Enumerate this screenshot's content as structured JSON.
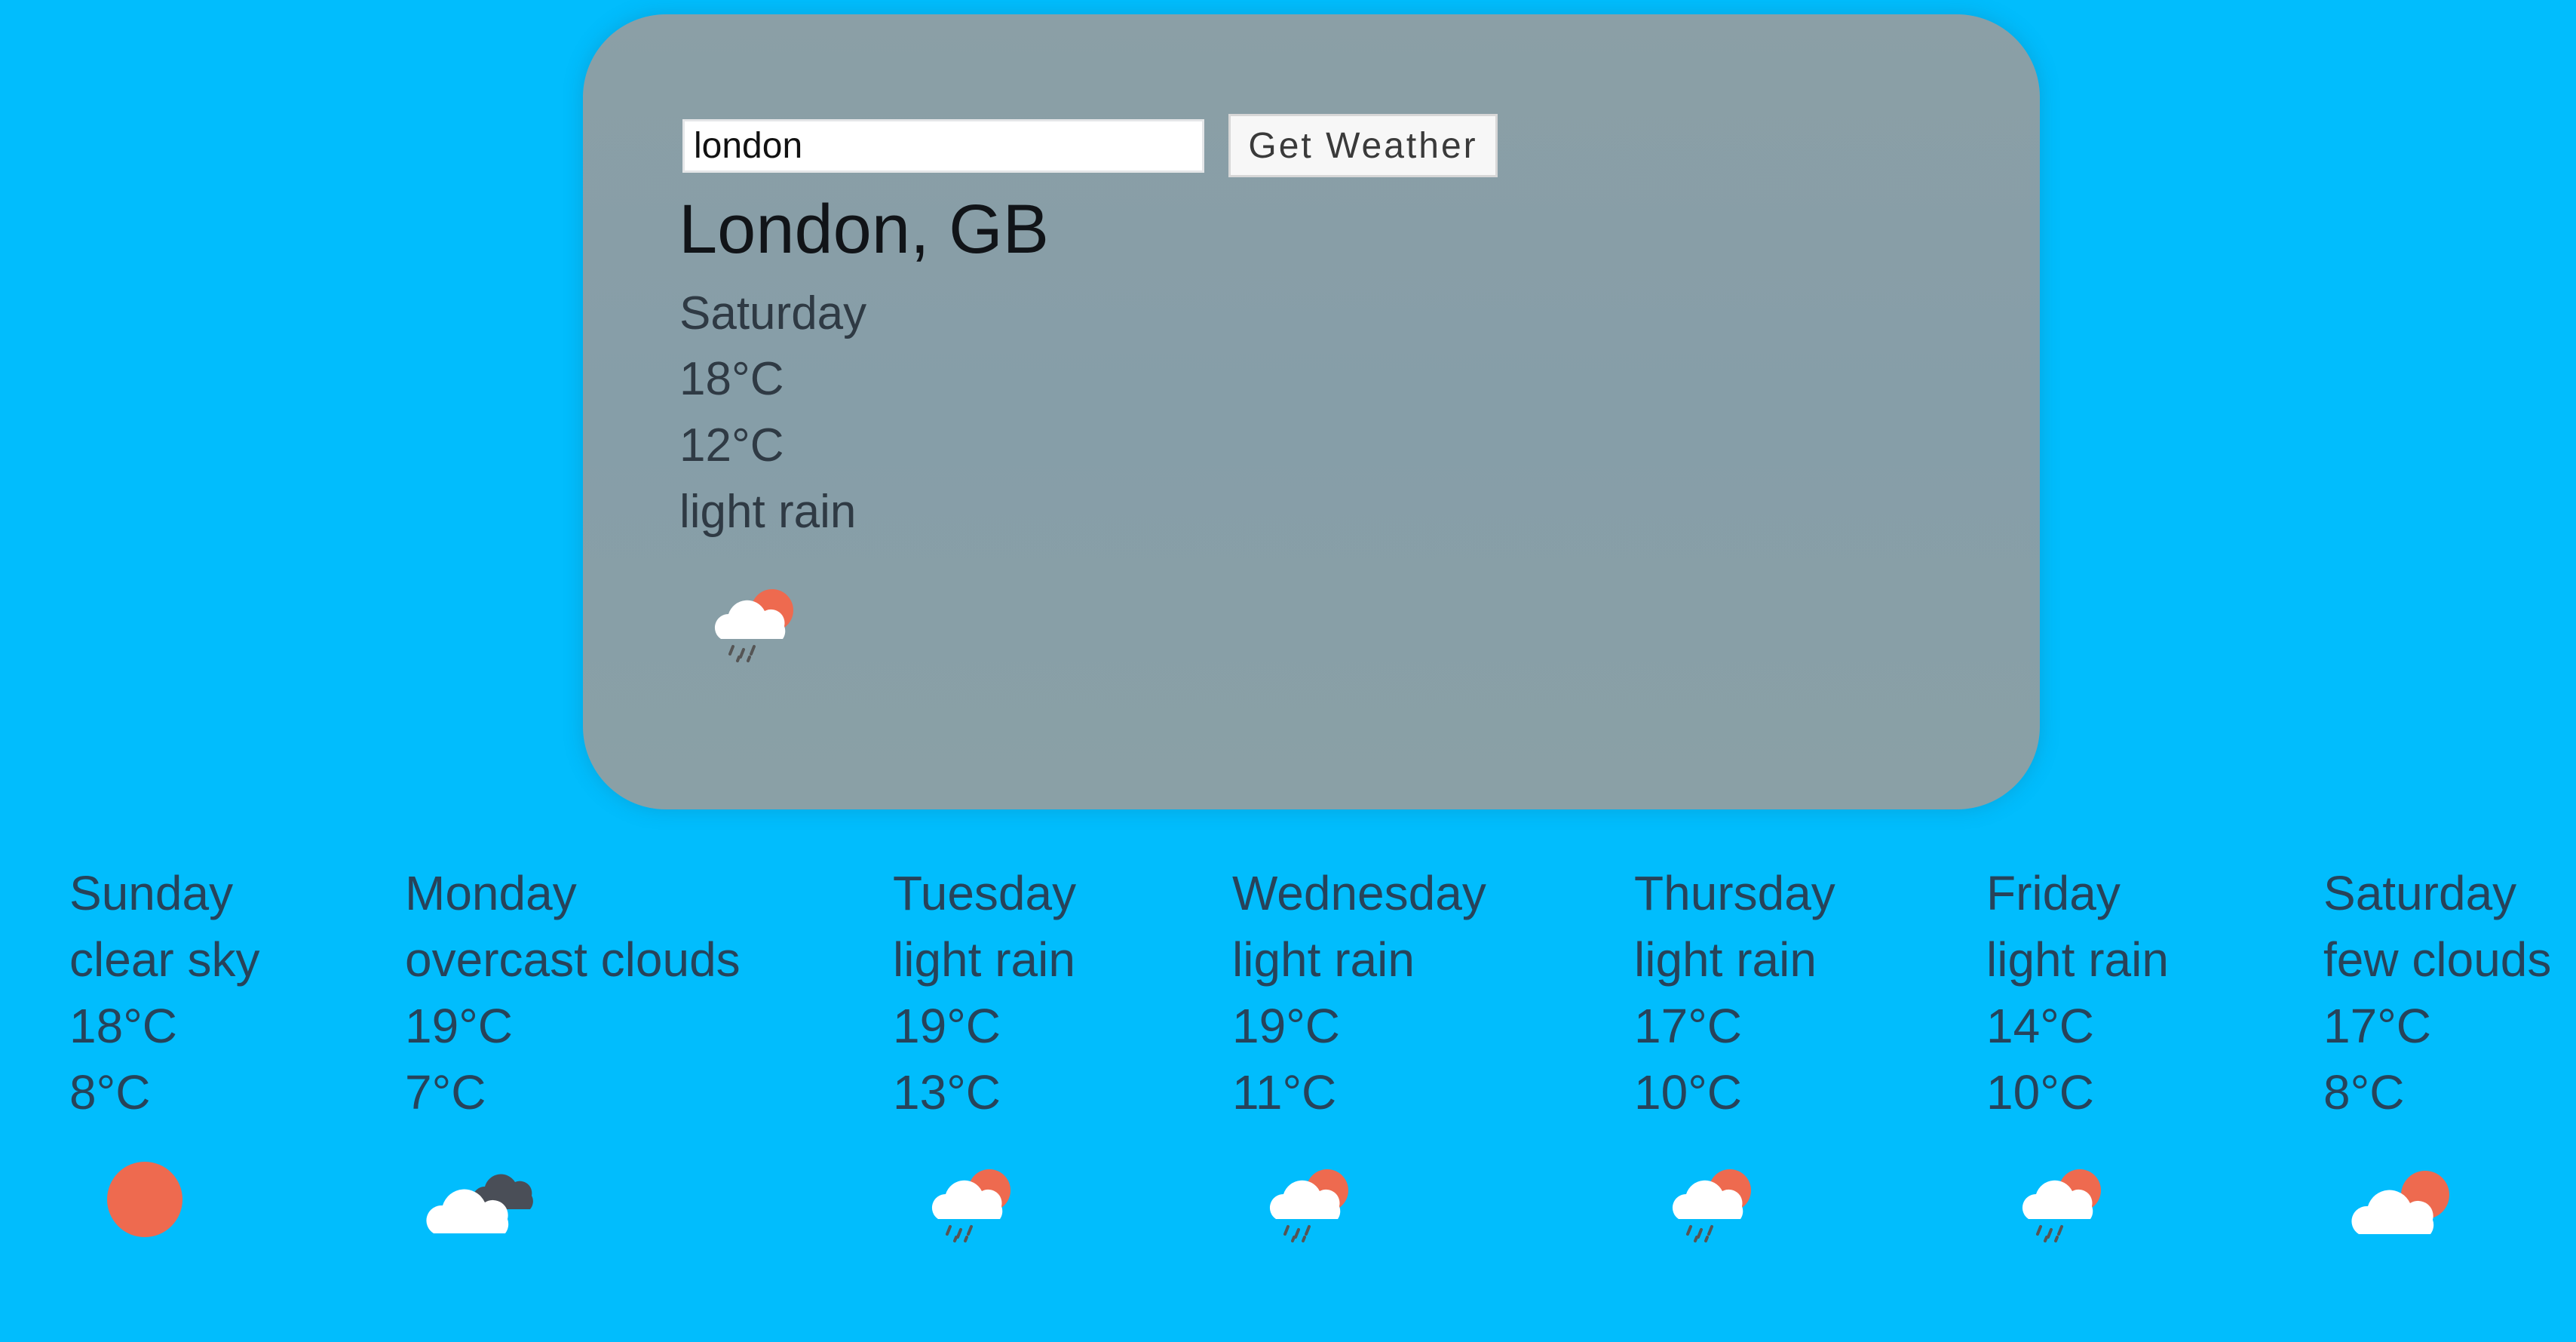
{
  "search": {
    "value": "london",
    "button_label": "Get Weather"
  },
  "current": {
    "city": "London, GB",
    "day": "Saturday",
    "max_temp": "18°C",
    "min_temp": "12°C",
    "description": "light rain",
    "icon": "light-rain-partly-sunny-icon"
  },
  "forecast": [
    {
      "day": "Sunday",
      "description": "clear sky",
      "max_temp": "18°C",
      "min_temp": "8°C",
      "icon": "sun-icon"
    },
    {
      "day": "Monday",
      "description": "overcast clouds",
      "max_temp": "19°C",
      "min_temp": "7°C",
      "icon": "overcast-clouds-icon"
    },
    {
      "day": "Tuesday",
      "description": "light rain",
      "max_temp": "19°C",
      "min_temp": "13°C",
      "icon": "light-rain-icon"
    },
    {
      "day": "Wednesday",
      "description": "light rain",
      "max_temp": "19°C",
      "min_temp": "11°C",
      "icon": "light-rain-icon"
    },
    {
      "day": "Thursday",
      "description": "light rain",
      "max_temp": "17°C",
      "min_temp": "10°C",
      "icon": "light-rain-icon"
    },
    {
      "day": "Friday",
      "description": "light rain",
      "max_temp": "14°C",
      "min_temp": "10°C",
      "icon": "light-rain-icon"
    },
    {
      "day": "Saturday",
      "description": "few clouds",
      "max_temp": "17°C",
      "min_temp": "8°C",
      "icon": "few-clouds-icon"
    }
  ],
  "colors": {
    "background": "#01bdfd",
    "card": "#8a9ea5",
    "sun": "#ee6a4f",
    "cloud": "#ffffff",
    "dark_cloud": "#4a4e57",
    "rain": "#555555"
  }
}
